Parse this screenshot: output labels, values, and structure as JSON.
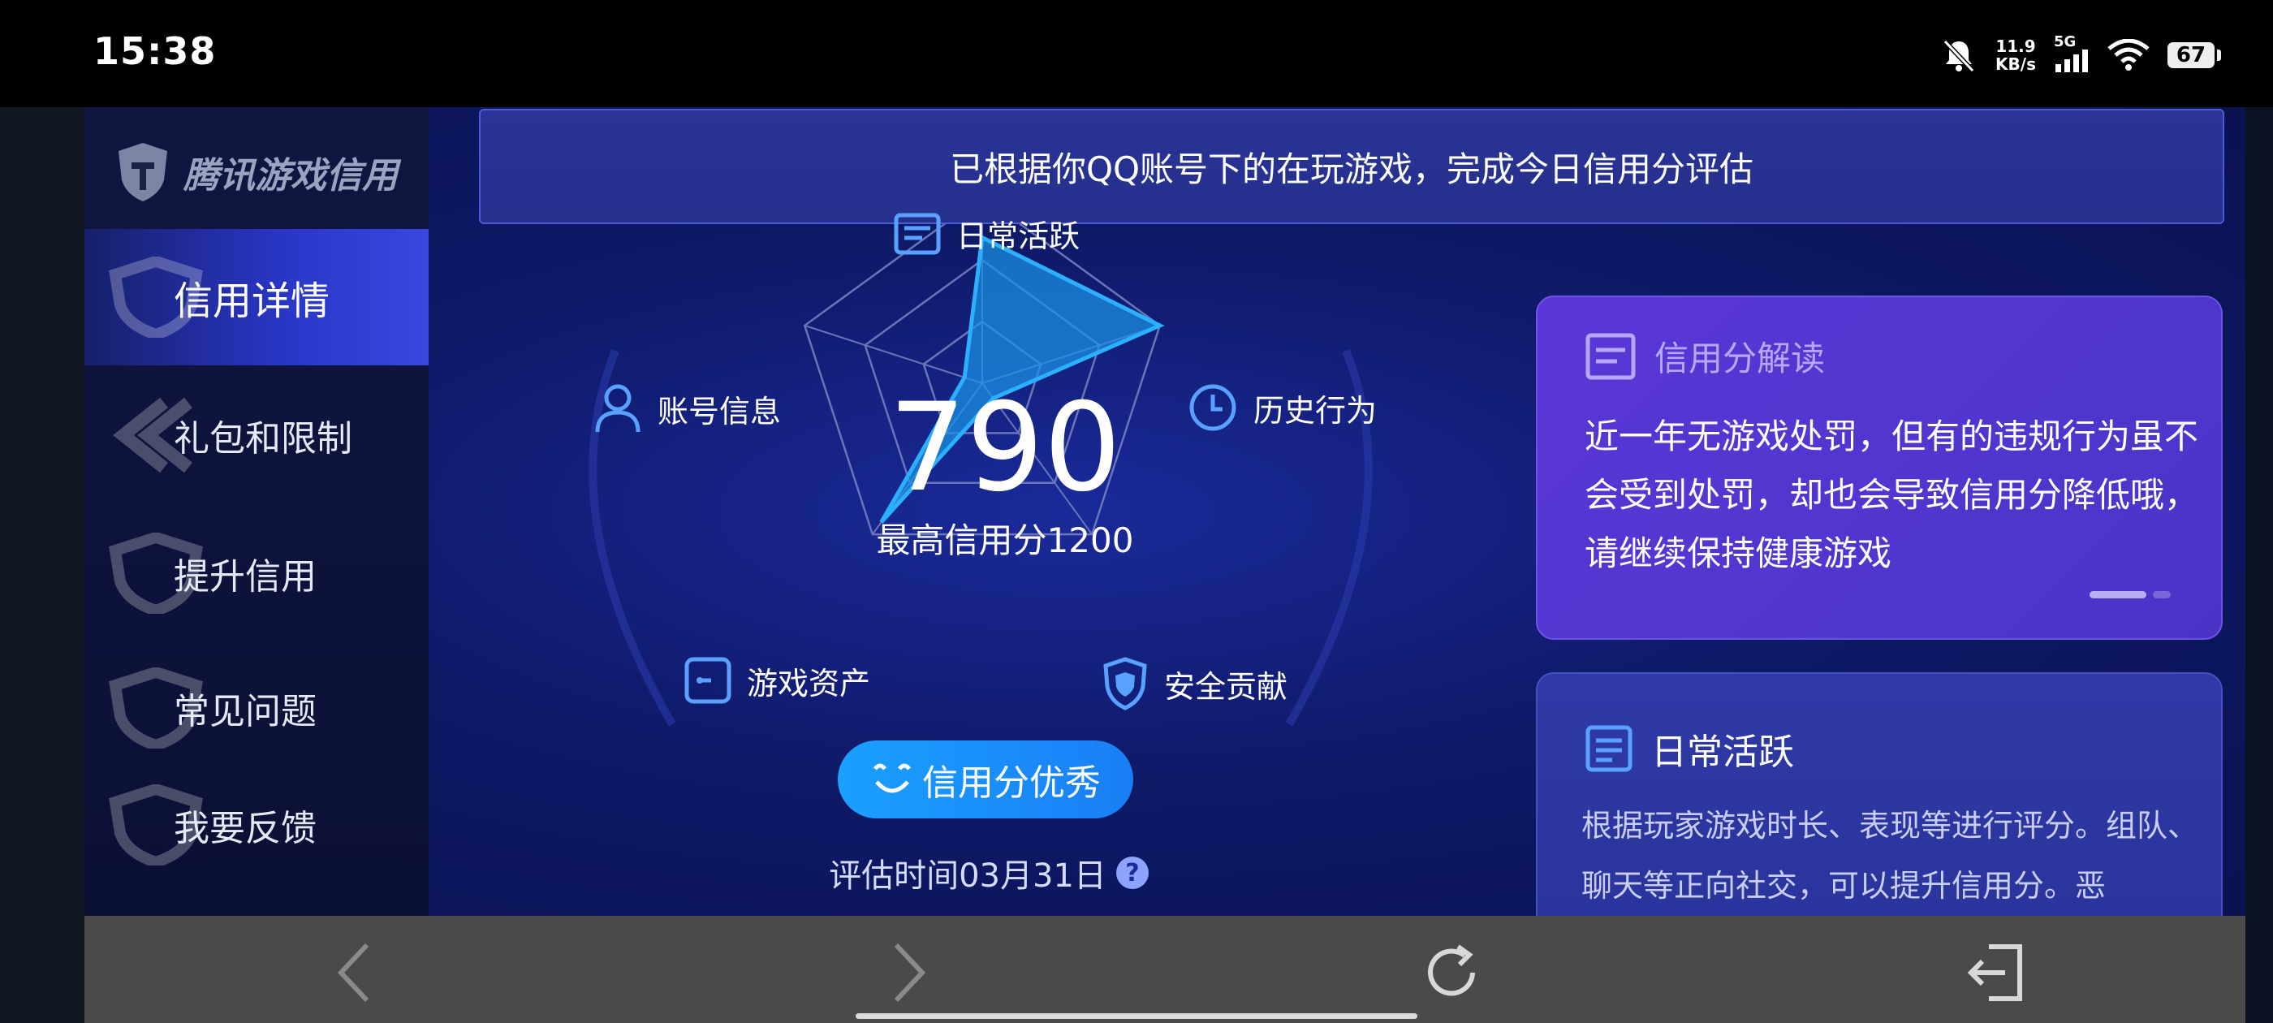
{
  "status_bar": {
    "time": "15:38",
    "speed_value": "11.9",
    "speed_unit": "KB/s",
    "network": "5G",
    "battery": "67"
  },
  "sidebar": {
    "logo_text": "腾讯游戏信用",
    "items": [
      {
        "label": "信用详情",
        "active": true
      },
      {
        "label": "礼包和限制",
        "active": false
      },
      {
        "label": "提升信用",
        "active": false
      },
      {
        "label": "常见问题",
        "active": false
      },
      {
        "label": "我要反馈",
        "active": false
      }
    ]
  },
  "banner": {
    "text": "已根据你QQ账号下的在玩游戏，完成今日信用分评估"
  },
  "score": {
    "value": "790",
    "max_text": "最高信用分1200",
    "badge_text": "信用分优秀",
    "eval_time": "评估时间03月31日",
    "help_icon": "?"
  },
  "radar": {
    "axes": [
      {
        "label": "日常活跃",
        "icon": "card-icon"
      },
      {
        "label": "历史行为",
        "icon": "clock-icon"
      },
      {
        "label": "安全贡献",
        "icon": "shield-icon"
      },
      {
        "label": "游戏资产",
        "icon": "wallet-icon"
      },
      {
        "label": "账号信息",
        "icon": "user-icon"
      }
    ],
    "values": [
      0.78,
      1.0,
      0.1,
      0.92,
      0.1
    ],
    "fill_color": "#1a96e8",
    "stroke_color": "#2ab0ff"
  },
  "cards": {
    "interpretation": {
      "title": "信用分解读",
      "body": "近一年无游戏处罚，但有的违规行为虽不会受到处罚，却也会导致信用分降低哦，请继续保持健康游戏"
    },
    "daily": {
      "title": "日常活跃",
      "body": "根据玩家游戏时长、表现等进行评分。组队、聊天等正向社交，可以提升信用分。恶"
    }
  },
  "colors": {
    "accent": "#1a8ef5",
    "card_purple": "#5236d0",
    "main_bg": "#0f1a6a"
  }
}
